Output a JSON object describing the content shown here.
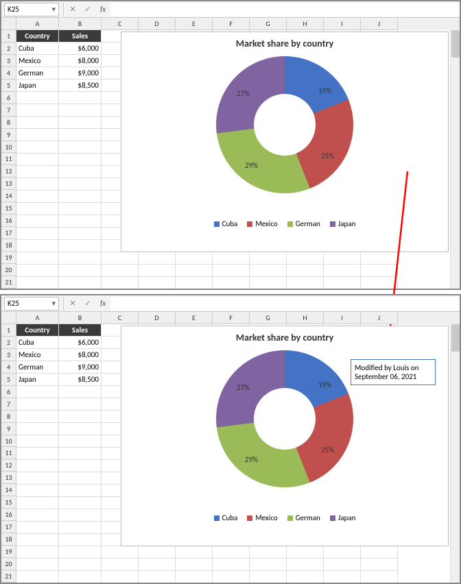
{
  "formula_bar": {
    "cell_ref": "K25",
    "fx_label": "fx"
  },
  "columns": [
    "A",
    "B",
    "C",
    "D",
    "E",
    "F",
    "G",
    "H",
    "I",
    "J"
  ],
  "row_count": 21,
  "table": {
    "headers": [
      "Country",
      "Sales"
    ],
    "rows": [
      {
        "country": "Cuba",
        "sales": "$6,000"
      },
      {
        "country": "Mexico",
        "sales": "$8,000"
      },
      {
        "country": "German",
        "sales": "$9,000"
      },
      {
        "country": "Japan",
        "sales": "$8,500"
      }
    ]
  },
  "chart_title": "Market share by country",
  "legend": [
    "Cuba",
    "Mexico",
    "German",
    "Japan"
  ],
  "pct": {
    "cuba": "19%",
    "mexico": "25%",
    "german": "29%",
    "japan": "27%"
  },
  "callout_text": "Modified by Louis on September 06, 2021",
  "chart_data": {
    "type": "pie",
    "title": "Market share by country",
    "categories": [
      "Cuba",
      "Mexico",
      "German",
      "Japan"
    ],
    "values": [
      6000,
      8000,
      9000,
      8500
    ],
    "percentages": [
      19,
      25,
      29,
      27
    ],
    "colors": {
      "Cuba": "#4472C4",
      "Mexico": "#C0504D",
      "German": "#9BBB59",
      "Japan": "#8064A2"
    },
    "donut": true
  }
}
